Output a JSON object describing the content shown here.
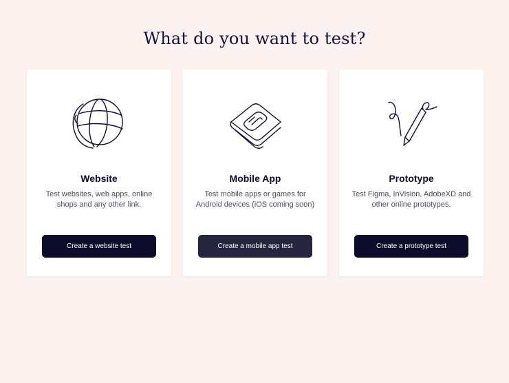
{
  "page": {
    "title": "What do you want to test?"
  },
  "colors": {
    "background": "#fcf3f0",
    "card": "#ffffff",
    "button": "#0e0c2b",
    "button_hover": "#262540",
    "text": "#0e0c2b"
  },
  "cards": [
    {
      "icon": "globe-icon",
      "title": "Website",
      "description": "Test websites, web apps, online shops and any other link.",
      "button_label": "Create a website test"
    },
    {
      "icon": "mobile-app-icon",
      "title": "Mobile App",
      "description": "Test mobile apps or games for Android devices (iOS coming soon)",
      "button_label": "Create a mobile app test"
    },
    {
      "icon": "prototype-pen-icon",
      "title": "Prototype",
      "description": "Test Figma, InVision, AdobeXD and other online prototypes.",
      "button_label": "Create a prototype test"
    }
  ]
}
